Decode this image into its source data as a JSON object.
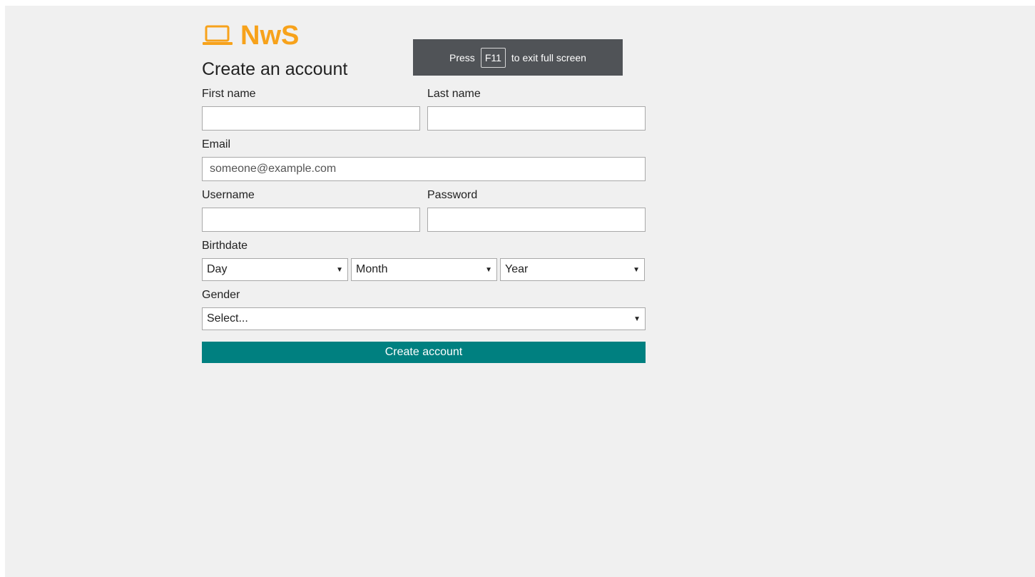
{
  "brand": {
    "name": "NwS",
    "icon": "laptop-icon",
    "color": "#f7a21b"
  },
  "form": {
    "title": "Create an account",
    "first_name_label": "First name",
    "last_name_label": "Last name",
    "email_label": "Email",
    "email_placeholder": "someone@example.com",
    "username_label": "Username",
    "password_label": "Password",
    "birthdate_label": "Birthdate",
    "day_value": "Day",
    "month_value": "Month",
    "year_value": "Year",
    "gender_label": "Gender",
    "gender_value": "Select...",
    "submit_label": "Create account",
    "submit_color": "#008080"
  },
  "fullscreen_toast": {
    "prefix": "Press",
    "key": "F11",
    "suffix": "to exit full screen"
  }
}
